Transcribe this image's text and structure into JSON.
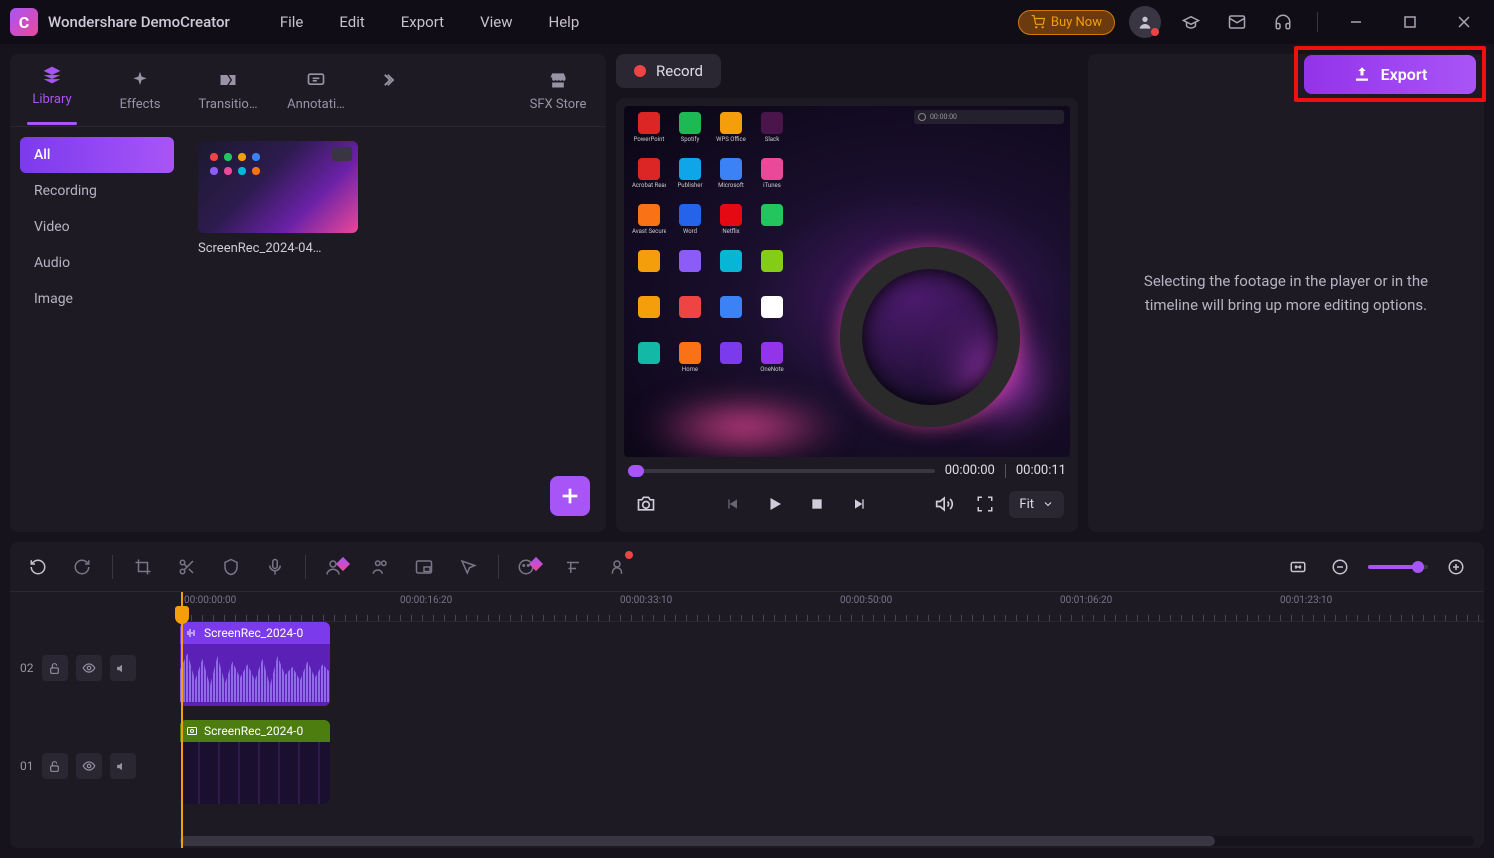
{
  "app": {
    "title": "Wondershare DemoCreator",
    "menu": [
      "File",
      "Edit",
      "Export",
      "View",
      "Help"
    ],
    "buy_now": "Buy Now"
  },
  "tabs": {
    "library": "Library",
    "effects": "Effects",
    "transitions": "Transitio…",
    "annotations": "Annotati…",
    "sfx": "SFX Store"
  },
  "categories": [
    "All",
    "Recording",
    "Video",
    "Audio",
    "Image"
  ],
  "media": {
    "item1_label": "ScreenRec_2024-04…"
  },
  "record_label": "Record",
  "export_label": "Export",
  "player": {
    "current": "00:00:00",
    "duration": "00:00:11",
    "fit": "Fit"
  },
  "right_panel_hint": "Selecting the footage in the player or in the timeline will bring up more editing options.",
  "timeline": {
    "ruler": [
      "00:00:00:00",
      "00:00:16:20",
      "00:00:33:10",
      "00:00:50:00",
      "00:01:06:20",
      "00:01:23:10"
    ],
    "tracks": {
      "t2_num": "02",
      "t1_num": "01",
      "clip_audio": "ScreenRec_2024-0",
      "clip_video": "ScreenRec_2024-0"
    }
  },
  "desktop_apps": [
    "PowerPoint",
    "Spotify",
    "WPS Office",
    "Slack",
    "Acrobat Reader",
    "Publisher",
    "Microsoft",
    "iTunes",
    "Avast Secure",
    "",
    "Word",
    "Netflix",
    "",
    "",
    "",
    "",
    "",
    "",
    "",
    "",
    "",
    "",
    "",
    "",
    "Home",
    "",
    "OneNote"
  ],
  "rec_bar_time": "00:00:00"
}
